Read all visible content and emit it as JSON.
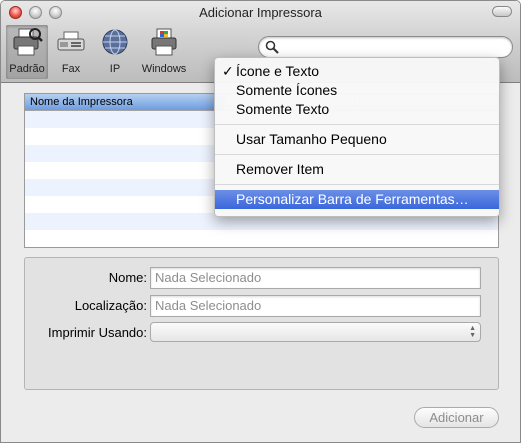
{
  "window": {
    "title": "Adicionar Impressora"
  },
  "toolbar": {
    "items": [
      {
        "label": "Padrão",
        "icon": "default-printer-icon"
      },
      {
        "label": "Fax",
        "icon": "fax-icon"
      },
      {
        "label": "IP",
        "icon": "ip-globe-icon"
      },
      {
        "label": "Windows",
        "icon": "windows-printer-icon"
      }
    ]
  },
  "search": {
    "placeholder": ""
  },
  "table": {
    "columns": [
      "Nome da Impressora",
      "",
      ""
    ]
  },
  "form": {
    "name_label": "Nome:",
    "name_value": "Nada Selecionado",
    "location_label": "Localização:",
    "location_value": "Nada Selecionado",
    "print_using_label": "Imprimir Usando:",
    "print_using_value": ""
  },
  "buttons": {
    "add": "Adicionar"
  },
  "context_menu": {
    "icon_and_text": "Ícone e Texto",
    "icon_only": "Somente Ícones",
    "text_only": "Somente Texto",
    "small_size": "Usar Tamanho Pequeno",
    "remove_item": "Remover Item",
    "customize_toolbar": "Personalizar Barra de Ferramentas…",
    "checkmark": "✓"
  },
  "colors": {
    "menu_highlight": "#3a66dc",
    "table_stripe": "#edf3fe"
  }
}
